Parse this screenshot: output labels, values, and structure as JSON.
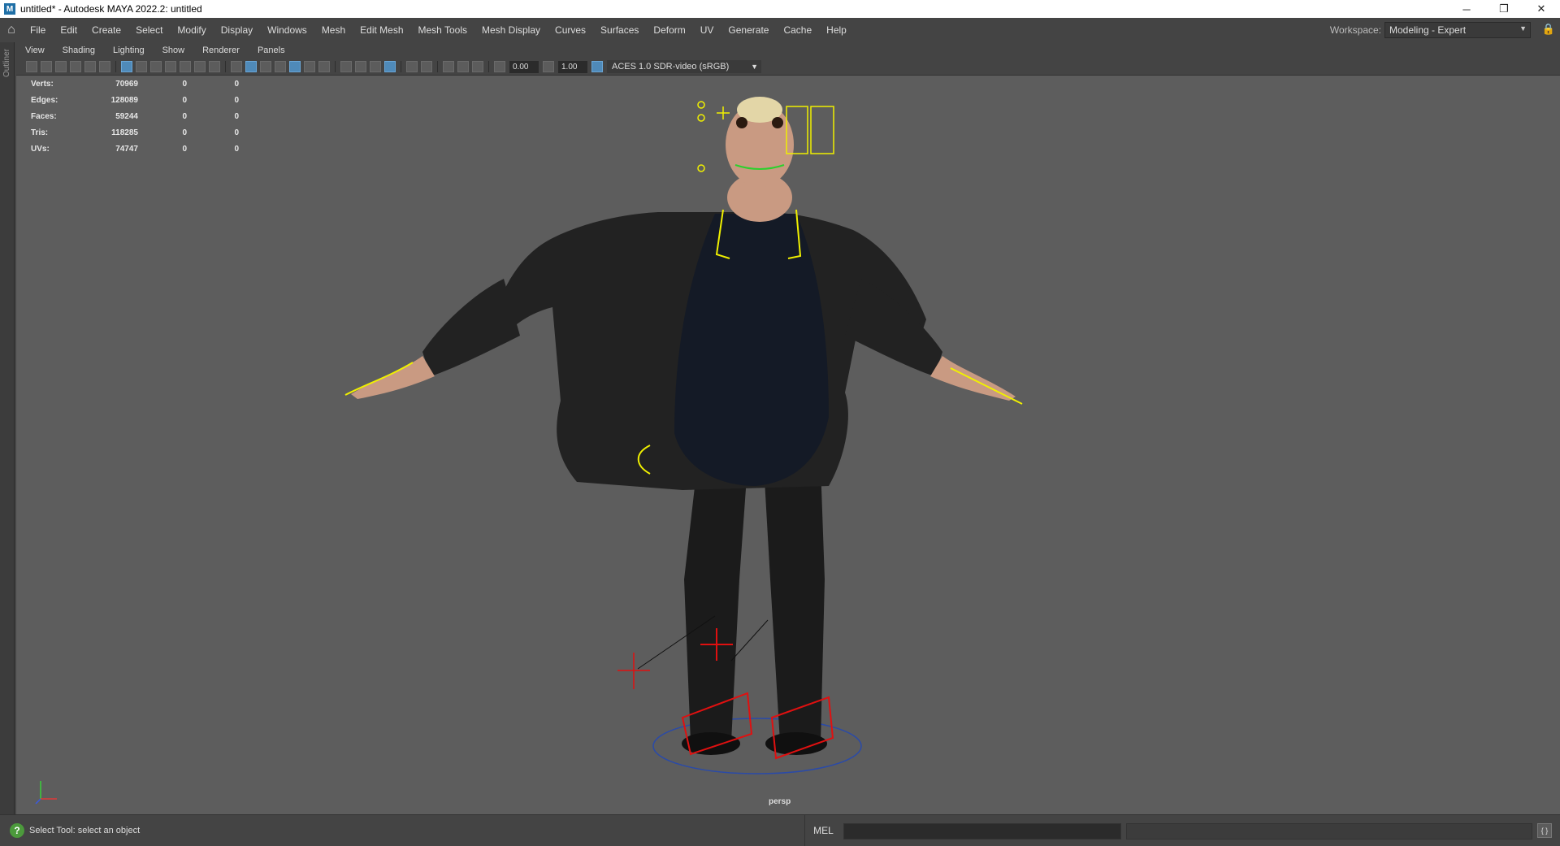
{
  "window": {
    "title": "untitled* - Autodesk MAYA 2022.2: untitled",
    "app_icon": "M",
    "minimize": "─",
    "maximize": "❐",
    "close": "✕"
  },
  "menu": [
    "File",
    "Edit",
    "Create",
    "Select",
    "Modify",
    "Display",
    "Windows",
    "Mesh",
    "Edit Mesh",
    "Mesh Tools",
    "Mesh Display",
    "Curves",
    "Surfaces",
    "Deform",
    "UV",
    "Generate",
    "Cache",
    "Help"
  ],
  "workspace": {
    "label": "Workspace:",
    "value": "Modeling - Expert"
  },
  "outliner_label": "Outliner",
  "panel_menu": [
    "View",
    "Shading",
    "Lighting",
    "Show",
    "Renderer",
    "Panels"
  ],
  "toolbar": {
    "near_value": "0.00",
    "far_value": "1.00",
    "color_management": "ACES 1.0 SDR-video (sRGB)"
  },
  "hud": [
    {
      "label": "Verts:",
      "v1": "70969",
      "v2": "0",
      "v3": "0"
    },
    {
      "label": "Edges:",
      "v1": "128089",
      "v2": "0",
      "v3": "0"
    },
    {
      "label": "Faces:",
      "v1": "59244",
      "v2": "0",
      "v3": "0"
    },
    {
      "label": "Tris:",
      "v1": "118285",
      "v2": "0",
      "v3": "0"
    },
    {
      "label": "UVs:",
      "v1": "74747",
      "v2": "0",
      "v3": "0"
    }
  ],
  "camera": "persp",
  "status": {
    "help_text": "Select Tool: select an object",
    "mel_label": "MEL"
  },
  "colors": {
    "viewport_bg": "#5d5d5d",
    "ui_bg": "#444444",
    "control_yellow": "#f0f000",
    "control_red": "#e01010",
    "highlight_blue": "#4f8ab9"
  }
}
